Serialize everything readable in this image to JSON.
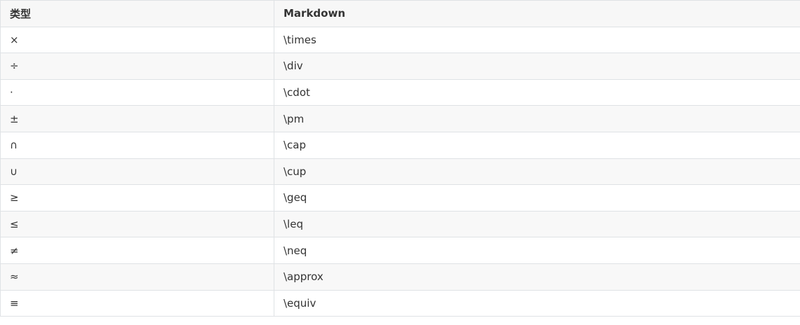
{
  "table": {
    "headers": [
      "类型",
      "Markdown"
    ],
    "rows": [
      {
        "symbol": "×",
        "markdown": "\\times"
      },
      {
        "symbol": "÷",
        "markdown": "\\div"
      },
      {
        "symbol": "·",
        "markdown": "\\cdot"
      },
      {
        "symbol": "±",
        "markdown": "\\pm"
      },
      {
        "symbol": "∩",
        "markdown": "\\cap"
      },
      {
        "symbol": "∪",
        "markdown": "\\cup"
      },
      {
        "symbol": "≥",
        "markdown": "\\geq"
      },
      {
        "symbol": "≤",
        "markdown": "\\leq"
      },
      {
        "symbol": "≠",
        "markdown": "\\neq"
      },
      {
        "symbol": "≈",
        "markdown": "\\approx"
      },
      {
        "symbol": "≡",
        "markdown": "\\equiv"
      }
    ]
  }
}
